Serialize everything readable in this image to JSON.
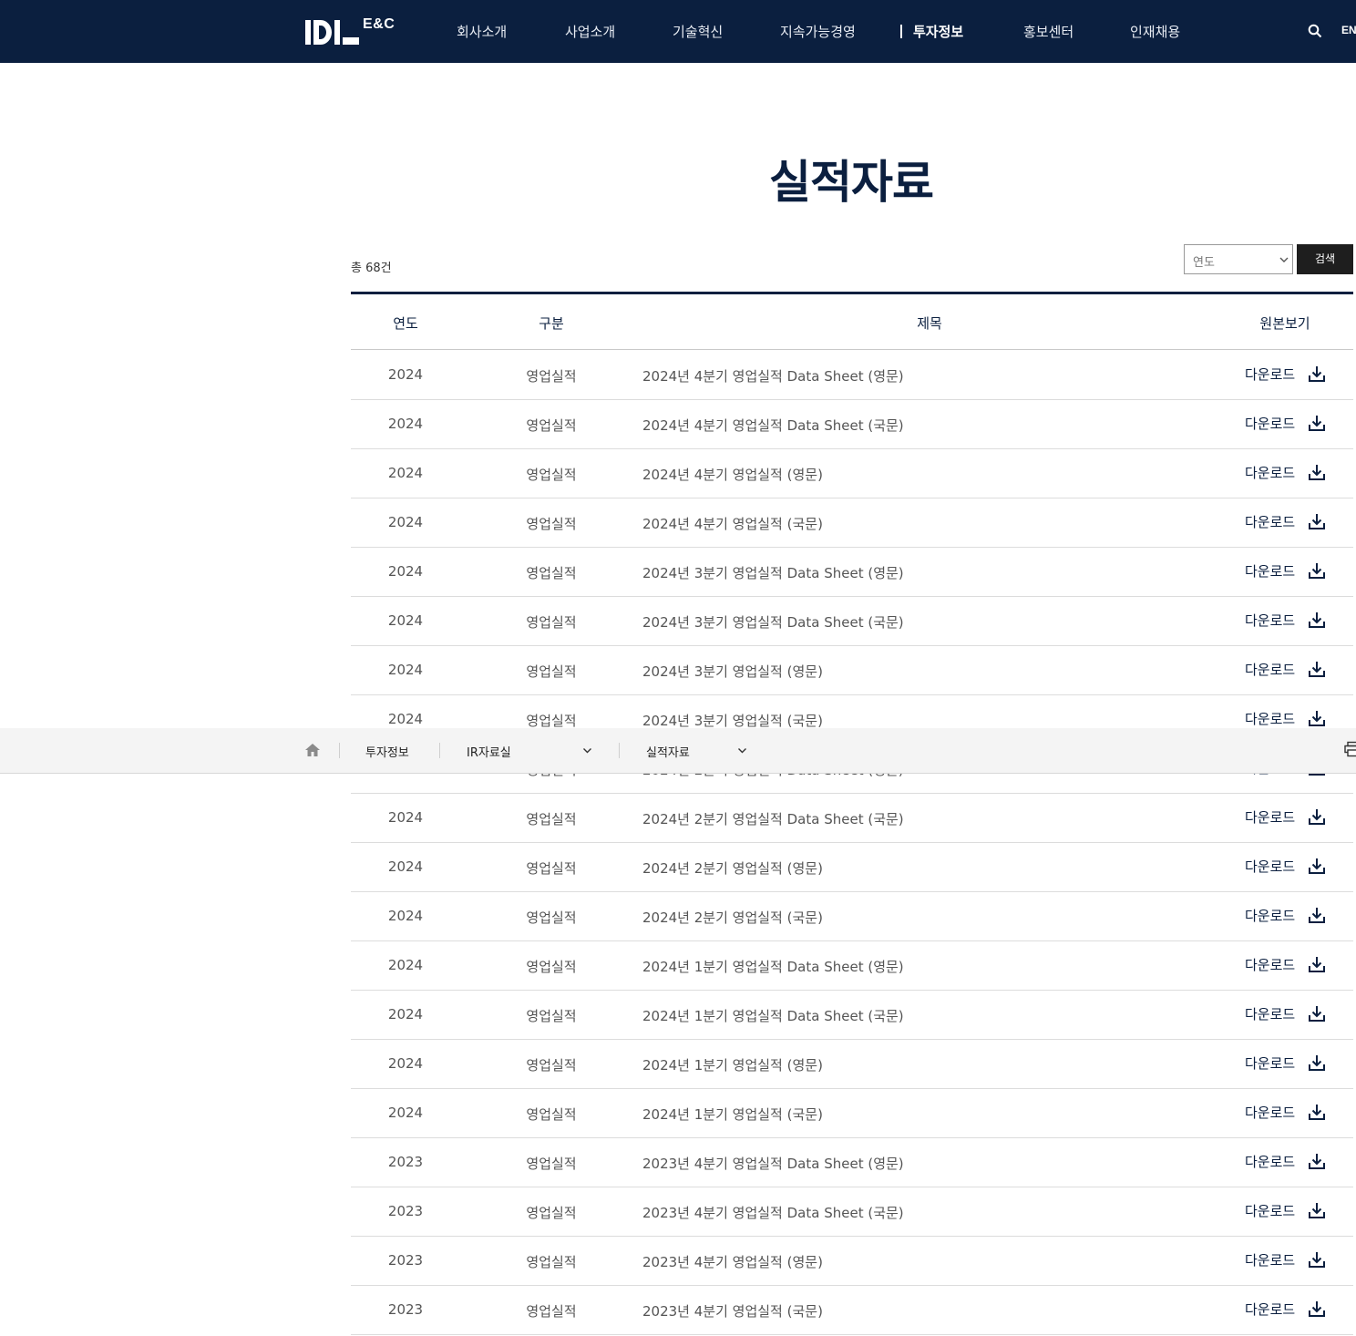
{
  "header": {
    "logo_sub": "E&C",
    "nav": [
      "회사소개",
      "사업소개",
      "기술혁신",
      "지속가능경영",
      "투자정보",
      "홍보센터",
      "인재채용"
    ],
    "active_nav": "투자정보",
    "lang": "EN"
  },
  "page": {
    "title": "실적자료",
    "total": "총 68건"
  },
  "filter": {
    "year_placeholder": "연도",
    "search_label": "검색"
  },
  "table": {
    "headers": [
      "연도",
      "구분",
      "제목",
      "원본보기"
    ],
    "download_label": "다운로드",
    "rows": [
      {
        "year": "2024",
        "type": "영업실적",
        "title": "2024년 4분기 영업실적 Data Sheet (영문)"
      },
      {
        "year": "2024",
        "type": "영업실적",
        "title": "2024년 4분기 영업실적 Data Sheet (국문)"
      },
      {
        "year": "2024",
        "type": "영업실적",
        "title": "2024년 4분기 영업실적 (영문)"
      },
      {
        "year": "2024",
        "type": "영업실적",
        "title": "2024년 4분기 영업실적 (국문)"
      },
      {
        "year": "2024",
        "type": "영업실적",
        "title": "2024년 3분기 영업실적 Data Sheet (영문)"
      },
      {
        "year": "2024",
        "type": "영업실적",
        "title": "2024년 3분기 영업실적 Data Sheet (국문)"
      },
      {
        "year": "2024",
        "type": "영업실적",
        "title": "2024년 3분기 영업실적 (영문)"
      },
      {
        "year": "2024",
        "type": "영업실적",
        "title": "2024년 3분기 영업실적 (국문)"
      },
      {
        "year": "2024",
        "type": "영업실적",
        "title": "2024년 2분기 영업실적 Data Sheet (영문)"
      },
      {
        "year": "2024",
        "type": "영업실적",
        "title": "2024년 2분기 영업실적 Data Sheet (국문)"
      },
      {
        "year": "2024",
        "type": "영업실적",
        "title": "2024년 2분기 영업실적 (영문)"
      },
      {
        "year": "2024",
        "type": "영업실적",
        "title": "2024년 2분기 영업실적 (국문)"
      },
      {
        "year": "2024",
        "type": "영업실적",
        "title": "2024년 1분기 영업실적 Data Sheet (영문)"
      },
      {
        "year": "2024",
        "type": "영업실적",
        "title": "2024년 1분기 영업실적 Data Sheet (국문)"
      },
      {
        "year": "2024",
        "type": "영업실적",
        "title": "2024년 1분기 영업실적 (영문)"
      },
      {
        "year": "2024",
        "type": "영업실적",
        "title": "2024년 1분기 영업실적 (국문)"
      },
      {
        "year": "2023",
        "type": "영업실적",
        "title": "2023년 4분기 영업실적 Data Sheet (영문)"
      },
      {
        "year": "2023",
        "type": "영업실적",
        "title": "2023년 4분기 영업실적 Data Sheet (국문)"
      },
      {
        "year": "2023",
        "type": "영업실적",
        "title": "2023년 4분기 영업실적 (영문)"
      },
      {
        "year": "2023",
        "type": "영업실적",
        "title": "2023년 4분기 영업실적 (국문)"
      }
    ]
  },
  "breadcrumb": {
    "level1": "투자정보",
    "level2": "IR자료실",
    "level3": "실적자료"
  },
  "colors": {
    "brand_navy": "#0b1f3f",
    "button_dark": "#1e1e1e"
  }
}
